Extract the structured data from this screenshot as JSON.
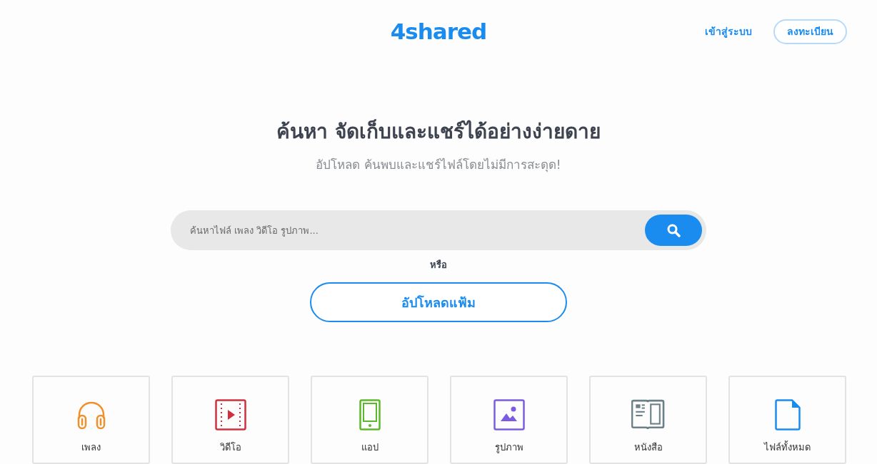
{
  "header": {
    "logo": "4shared",
    "login_link": "เข้าสู่ระบบ",
    "register_button": "ลงทะเบียน"
  },
  "hero": {
    "title": "ค้นหา จัดเก็บและแชร์ได้อย่างง่ายดาย",
    "subtitle": "อัปโหลด ค้นพบและแชร์ไฟล์โดยไม่มีการสะดุด!"
  },
  "search": {
    "placeholder": "ค้นหาไฟล์ เพลง วิดีโอ รูปภาพ..."
  },
  "or_label": "หรือ",
  "upload_button": "อัปโหลดแฟ้ม",
  "categories": [
    {
      "label": "เพลง",
      "kind": "music",
      "color": "#f0902a"
    },
    {
      "label": "วิดีโอ",
      "kind": "video",
      "color": "#d0303e"
    },
    {
      "label": "แอป",
      "kind": "app",
      "color": "#5cb82a"
    },
    {
      "label": "รูปภาพ",
      "kind": "image",
      "color": "#7b5ce0"
    },
    {
      "label": "หนังสือ",
      "kind": "book",
      "color": "#6c8088"
    },
    {
      "label": "ไฟล์ทั้งหมด",
      "kind": "file",
      "color": "#1a8cf0"
    }
  ]
}
